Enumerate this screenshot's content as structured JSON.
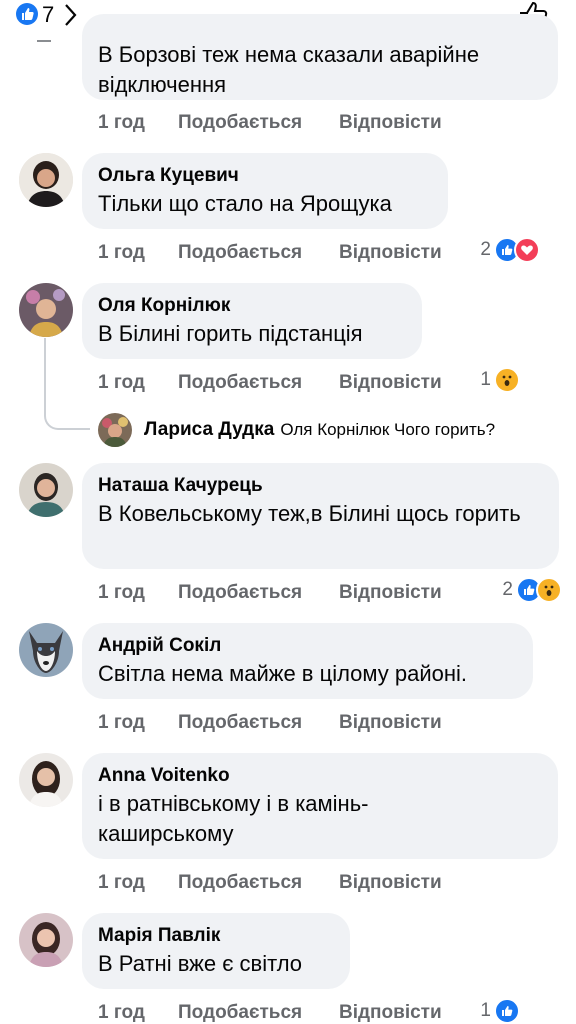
{
  "header": {
    "reaction_count": "7"
  },
  "colors": {
    "accent": "#1877f2",
    "bubble": "#f0f2f5",
    "meta_text": "#65676b",
    "love": "#f33e58",
    "wow": "#f7b125"
  },
  "comments": [
    {
      "name": "",
      "text": "В Борзові теж нема сказали аварійне відключення",
      "time": "1 год",
      "like": "Подобається",
      "reply": "Відповісти",
      "reaction_count": "",
      "reactions": []
    },
    {
      "name": "Ольга Куцевич",
      "text": "Тільки що стало на Ярощука",
      "time": "1 год",
      "like": "Подобається",
      "reply": "Відповісти",
      "reaction_count": "2",
      "reactions": [
        "like-icon",
        "love-icon"
      ]
    },
    {
      "name": "Оля Корнілюк",
      "text": "В Білині горить підстанція",
      "time": "1 год",
      "like": "Подобається",
      "reply": "Відповісти",
      "reaction_count": "1",
      "reactions": [
        "wow-icon"
      ]
    },
    {
      "name": "Наташа Качурець",
      "text": "В Ковельському теж,в Білині щось горить",
      "time": "1 год",
      "like": "Подобається",
      "reply": "Відповісти",
      "reaction_count": "2",
      "reactions": [
        "like-icon",
        "wow-icon"
      ]
    },
    {
      "name": "Андрій Сокіл",
      "text": "Світла нема майже в цілому районі.",
      "time": "1 год",
      "like": "Подобається",
      "reply": "Відповісти",
      "reaction_count": "",
      "reactions": []
    },
    {
      "name": "Anna Voitenko",
      "text": "і в ратнівському і в камінь-каширському",
      "time": "1 год",
      "like": "Подобається",
      "reply": "Відповісти",
      "reaction_count": "",
      "reactions": []
    },
    {
      "name": "Марія Павлік",
      "text": "В Ратні вже є світло",
      "time": "1 год",
      "like": "Подобається",
      "reply": "Відповісти",
      "reaction_count": "1",
      "reactions": [
        "like-icon"
      ]
    }
  ],
  "reply_preview": {
    "name": "Лариса Дудка",
    "text": "Оля Корнілюк Чого горить?"
  }
}
